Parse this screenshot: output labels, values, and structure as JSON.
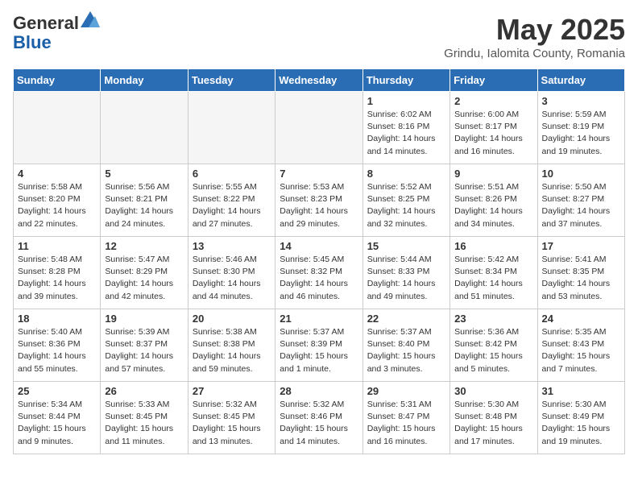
{
  "header": {
    "logo_general": "General",
    "logo_blue": "Blue",
    "month_title": "May 2025",
    "location": "Grindu, Ialomita County, Romania"
  },
  "weekdays": [
    "Sunday",
    "Monday",
    "Tuesday",
    "Wednesday",
    "Thursday",
    "Friday",
    "Saturday"
  ],
  "weeks": [
    [
      {
        "num": "",
        "empty": true
      },
      {
        "num": "",
        "empty": true
      },
      {
        "num": "",
        "empty": true
      },
      {
        "num": "",
        "empty": true
      },
      {
        "num": "1",
        "sunrise": "6:02 AM",
        "sunset": "8:16 PM",
        "daylight": "14 hours and 14 minutes."
      },
      {
        "num": "2",
        "sunrise": "6:00 AM",
        "sunset": "8:17 PM",
        "daylight": "14 hours and 16 minutes."
      },
      {
        "num": "3",
        "sunrise": "5:59 AM",
        "sunset": "8:19 PM",
        "daylight": "14 hours and 19 minutes."
      }
    ],
    [
      {
        "num": "4",
        "sunrise": "5:58 AM",
        "sunset": "8:20 PM",
        "daylight": "14 hours and 22 minutes."
      },
      {
        "num": "5",
        "sunrise": "5:56 AM",
        "sunset": "8:21 PM",
        "daylight": "14 hours and 24 minutes."
      },
      {
        "num": "6",
        "sunrise": "5:55 AM",
        "sunset": "8:22 PM",
        "daylight": "14 hours and 27 minutes."
      },
      {
        "num": "7",
        "sunrise": "5:53 AM",
        "sunset": "8:23 PM",
        "daylight": "14 hours and 29 minutes."
      },
      {
        "num": "8",
        "sunrise": "5:52 AM",
        "sunset": "8:25 PM",
        "daylight": "14 hours and 32 minutes."
      },
      {
        "num": "9",
        "sunrise": "5:51 AM",
        "sunset": "8:26 PM",
        "daylight": "14 hours and 34 minutes."
      },
      {
        "num": "10",
        "sunrise": "5:50 AM",
        "sunset": "8:27 PM",
        "daylight": "14 hours and 37 minutes."
      }
    ],
    [
      {
        "num": "11",
        "sunrise": "5:48 AM",
        "sunset": "8:28 PM",
        "daylight": "14 hours and 39 minutes."
      },
      {
        "num": "12",
        "sunrise": "5:47 AM",
        "sunset": "8:29 PM",
        "daylight": "14 hours and 42 minutes."
      },
      {
        "num": "13",
        "sunrise": "5:46 AM",
        "sunset": "8:30 PM",
        "daylight": "14 hours and 44 minutes."
      },
      {
        "num": "14",
        "sunrise": "5:45 AM",
        "sunset": "8:32 PM",
        "daylight": "14 hours and 46 minutes."
      },
      {
        "num": "15",
        "sunrise": "5:44 AM",
        "sunset": "8:33 PM",
        "daylight": "14 hours and 49 minutes."
      },
      {
        "num": "16",
        "sunrise": "5:42 AM",
        "sunset": "8:34 PM",
        "daylight": "14 hours and 51 minutes."
      },
      {
        "num": "17",
        "sunrise": "5:41 AM",
        "sunset": "8:35 PM",
        "daylight": "14 hours and 53 minutes."
      }
    ],
    [
      {
        "num": "18",
        "sunrise": "5:40 AM",
        "sunset": "8:36 PM",
        "daylight": "14 hours and 55 minutes."
      },
      {
        "num": "19",
        "sunrise": "5:39 AM",
        "sunset": "8:37 PM",
        "daylight": "14 hours and 57 minutes."
      },
      {
        "num": "20",
        "sunrise": "5:38 AM",
        "sunset": "8:38 PM",
        "daylight": "14 hours and 59 minutes."
      },
      {
        "num": "21",
        "sunrise": "5:37 AM",
        "sunset": "8:39 PM",
        "daylight": "15 hours and 1 minute."
      },
      {
        "num": "22",
        "sunrise": "5:37 AM",
        "sunset": "8:40 PM",
        "daylight": "15 hours and 3 minutes."
      },
      {
        "num": "23",
        "sunrise": "5:36 AM",
        "sunset": "8:42 PM",
        "daylight": "15 hours and 5 minutes."
      },
      {
        "num": "24",
        "sunrise": "5:35 AM",
        "sunset": "8:43 PM",
        "daylight": "15 hours and 7 minutes."
      }
    ],
    [
      {
        "num": "25",
        "sunrise": "5:34 AM",
        "sunset": "8:44 PM",
        "daylight": "15 hours and 9 minutes."
      },
      {
        "num": "26",
        "sunrise": "5:33 AM",
        "sunset": "8:45 PM",
        "daylight": "15 hours and 11 minutes."
      },
      {
        "num": "27",
        "sunrise": "5:32 AM",
        "sunset": "8:45 PM",
        "daylight": "15 hours and 13 minutes."
      },
      {
        "num": "28",
        "sunrise": "5:32 AM",
        "sunset": "8:46 PM",
        "daylight": "15 hours and 14 minutes."
      },
      {
        "num": "29",
        "sunrise": "5:31 AM",
        "sunset": "8:47 PM",
        "daylight": "15 hours and 16 minutes."
      },
      {
        "num": "30",
        "sunrise": "5:30 AM",
        "sunset": "8:48 PM",
        "daylight": "15 hours and 17 minutes."
      },
      {
        "num": "31",
        "sunrise": "5:30 AM",
        "sunset": "8:49 PM",
        "daylight": "15 hours and 19 minutes."
      }
    ]
  ],
  "labels": {
    "sunrise": "Sunrise:",
    "sunset": "Sunset:",
    "daylight": "Daylight:"
  }
}
